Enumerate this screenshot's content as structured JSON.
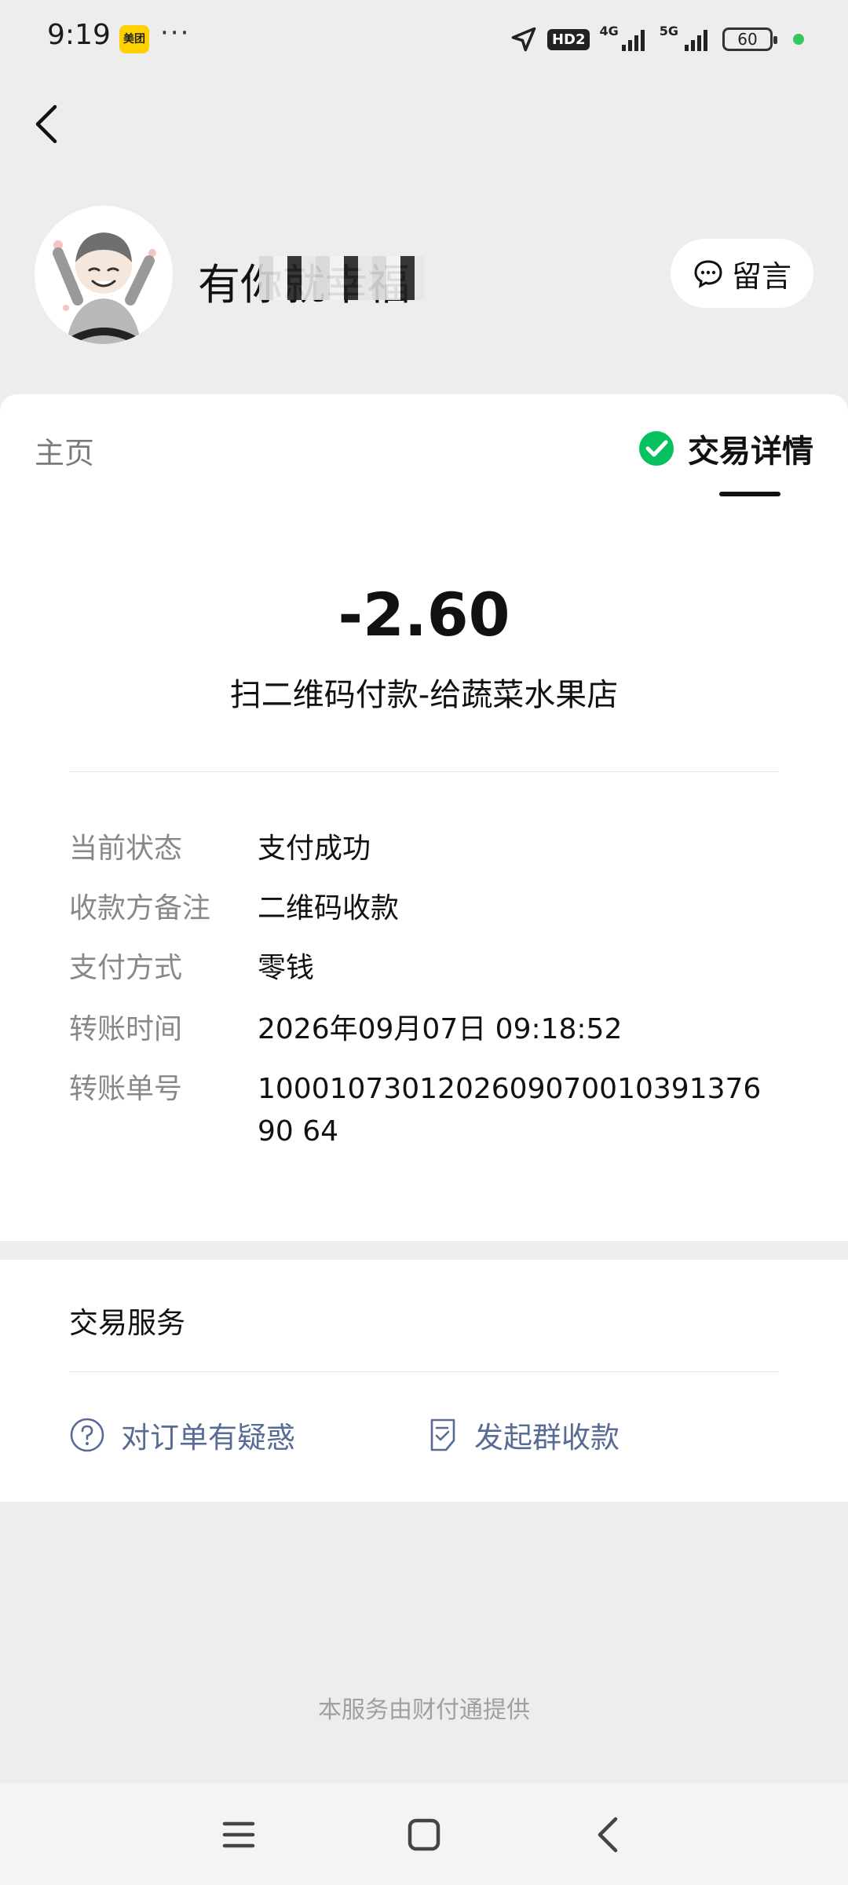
{
  "status_bar": {
    "time": "9:19",
    "app_badge": "美团",
    "more_dots": "···",
    "network_badge": "HD2",
    "net_4g": "4G",
    "net_5g": "5G",
    "battery": "60"
  },
  "header": {
    "profile_name": "有你就幸福",
    "message_button": "留言"
  },
  "tabs": {
    "home": "主页",
    "detail": "交易详情"
  },
  "transaction": {
    "amount": "-2.60",
    "title": "扫二维码付款-给蔬菜水果店",
    "rows": [
      {
        "label": "当前状态",
        "value": "支付成功"
      },
      {
        "label": "收款方备注",
        "value": "二维码收款"
      },
      {
        "label": "支付方式",
        "value": "零钱"
      },
      {
        "label": "转账时间",
        "value": "2026年09月07日 09:18:52"
      },
      {
        "label": "转账单号",
        "value": "100010730120260907001039137690 64"
      }
    ]
  },
  "services": {
    "title": "交易服务",
    "question_label": "对订单有疑惑",
    "group_collect_label": "发起群收款"
  },
  "footer": {
    "note": "本服务由财付通提供"
  },
  "colors": {
    "wechat_green": "#07c160",
    "link_blue": "#576b95"
  }
}
